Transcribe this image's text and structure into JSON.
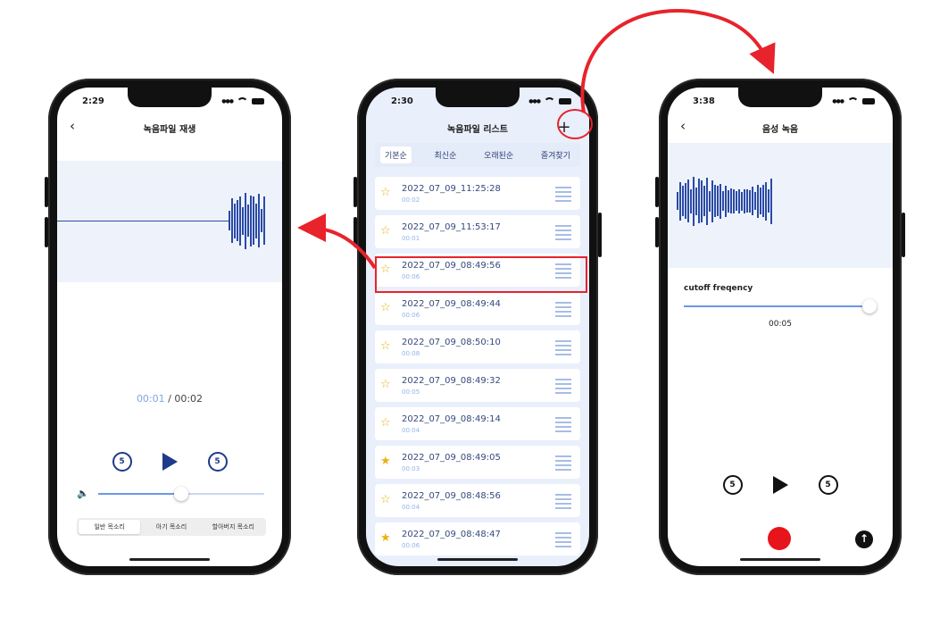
{
  "left_phone": {
    "time": "2:29",
    "title": "녹음파일 재생",
    "back_icon": "‹",
    "time_current": "00:01",
    "time_total": "/ 00:02",
    "volume_level": 0.5,
    "voice_options": [
      "일반 목소리",
      "아기 목소리",
      "할아버지 목소리"
    ],
    "voice_selected": "일반 목소리",
    "rewind_label": "5",
    "forward_label": "5"
  },
  "middle_phone": {
    "time": "2:30",
    "title": "녹음파일 리스트",
    "add_icon": "+",
    "tabs": [
      "기본순",
      "최신순",
      "오래된순",
      "즐겨찾기"
    ],
    "active_tab": "기본순",
    "recordings": [
      {
        "name": "2022_07_09_11:25:28",
        "duration": "00:02",
        "favorite": false
      },
      {
        "name": "2022_07_09_11:53:17",
        "duration": "00:01",
        "favorite": false
      },
      {
        "name": "2022_07_09_08:49:56",
        "duration": "00:06",
        "favorite": false,
        "highlighted": true
      },
      {
        "name": "2022_07_09_08:49:44",
        "duration": "00:06",
        "favorite": false
      },
      {
        "name": "2022_07_09_08:50:10",
        "duration": "00:08",
        "favorite": false
      },
      {
        "name": "2022_07_09_08:49:32",
        "duration": "00:05",
        "favorite": false
      },
      {
        "name": "2022_07_09_08:49:14",
        "duration": "00:04",
        "favorite": false
      },
      {
        "name": "2022_07_09_08:49:05",
        "duration": "00:03",
        "favorite": true
      },
      {
        "name": "2022_07_09_08:48:56",
        "duration": "00:04",
        "favorite": false
      },
      {
        "name": "2022_07_09_08:48:47",
        "duration": "00:06",
        "favorite": true
      }
    ]
  },
  "right_phone": {
    "time": "3:38",
    "title": "음성 녹음",
    "back_icon": "‹",
    "cutoff_label": "cutoff freqency",
    "cutoff_level": 1.0,
    "elapsed": "00:05",
    "rewind_label": "5",
    "forward_label": "5",
    "upload_icon": "↑"
  },
  "colors": {
    "accent": "#2a4aa6",
    "highlight": "#e8232c",
    "record": "#e8141b",
    "star": "#e8b20e"
  }
}
